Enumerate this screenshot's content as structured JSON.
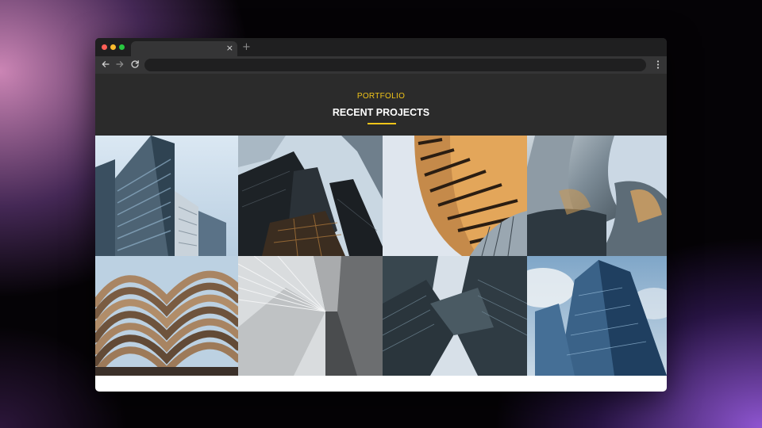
{
  "browser": {
    "tab_close_glyph": "×",
    "new_tab_glyph": "+",
    "icons": [
      "back-arrow-icon",
      "forward-arrow-icon",
      "reload-icon",
      "kebab-menu-icon"
    ]
  },
  "portfolio": {
    "eyebrow": "PORTFOLIO",
    "title": "RECENT PROJECTS",
    "accent_color": "#f0c419"
  },
  "gallery": {
    "columns": 4,
    "rows": 2,
    "items": [
      {
        "subject": "glass apartment tower against blue sky"
      },
      {
        "subject": "dark glass skyscrapers looking up"
      },
      {
        "subject": "curved orange louvered facade"
      },
      {
        "subject": "stainless steel curved concert hall"
      },
      {
        "subject": "wavy balconies on concrete building"
      },
      {
        "subject": "white cable-stayed bridge pylon"
      },
      {
        "subject": "twisting glass towers from below"
      },
      {
        "subject": "blue glass skyscraper with clouds"
      }
    ]
  }
}
